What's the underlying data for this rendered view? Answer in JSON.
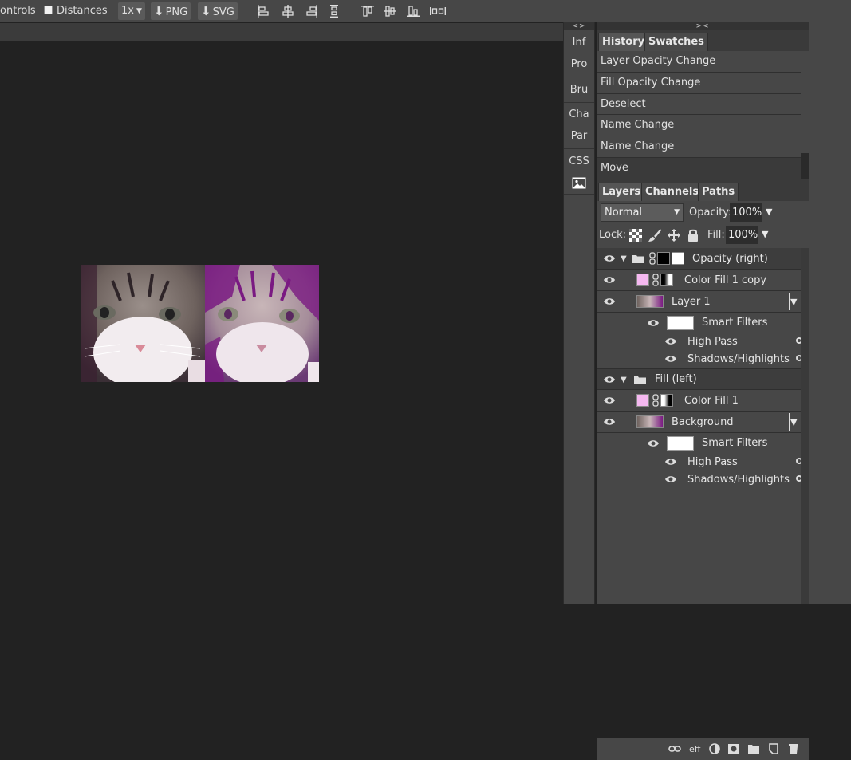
{
  "toolbar": {
    "controls_label": "ontrols",
    "distances_label": "Distances",
    "scale_label": "1x",
    "png_label": "PNG",
    "svg_label": "SVG",
    "align_icons": [
      "align-left-icon",
      "align-center-h-icon",
      "align-right-icon",
      "distribute-h-icon",
      "align-top-icon",
      "align-middle-v-icon",
      "align-bottom-icon",
      "distribute-v-icon"
    ]
  },
  "mid_panel": {
    "collapse_label": "<>",
    "items": [
      "Inf",
      "Pro",
      "Bru",
      "Cha",
      "Par",
      "CSS"
    ]
  },
  "right_panel": {
    "collapse_label": "><",
    "history_tabs": [
      "History",
      "Swatches"
    ],
    "history_items": [
      "Layer Opacity Change",
      "Fill Opacity Change",
      "Deselect",
      "Name Change",
      "Name Change",
      "Move"
    ],
    "layer_tabs": [
      "Layers",
      "Channels",
      "Paths"
    ],
    "blend_mode": "Normal",
    "opacity_label": "Opacity:",
    "opacity_value": "100%",
    "lock_label": "Lock:",
    "fill_label": "Fill:",
    "fill_value": "100%",
    "layers": [
      {
        "name": "Opacity (right)",
        "type": "group"
      },
      {
        "name": "Color Fill 1 copy",
        "type": "fill"
      },
      {
        "name": "Layer 1",
        "type": "smart"
      },
      {
        "name": "Smart Filters",
        "type": "filters"
      },
      {
        "name": "High Pass",
        "type": "filter"
      },
      {
        "name": "Shadows/Highlights",
        "type": "filter"
      },
      {
        "name": "Fill (left)",
        "type": "group"
      },
      {
        "name": "Color Fill 1",
        "type": "fill"
      },
      {
        "name": "Background",
        "type": "smart"
      },
      {
        "name": "Smart Filters",
        "type": "filters"
      },
      {
        "name": "High Pass",
        "type": "filter"
      },
      {
        "name": "Shadows/Highlights",
        "type": "filter"
      }
    ],
    "bottom_icons": [
      "link-icon",
      "effects-icon",
      "adjustment-icon",
      "mask-icon",
      "new-group-icon",
      "new-layer-icon",
      "trash-icon"
    ],
    "effects_label": "eff"
  },
  "colors": {
    "canvas_bg": "#222222",
    "panel_bg": "#474747",
    "fill_color": "#f5b8f0",
    "accent_purple": "#7a1a82"
  }
}
